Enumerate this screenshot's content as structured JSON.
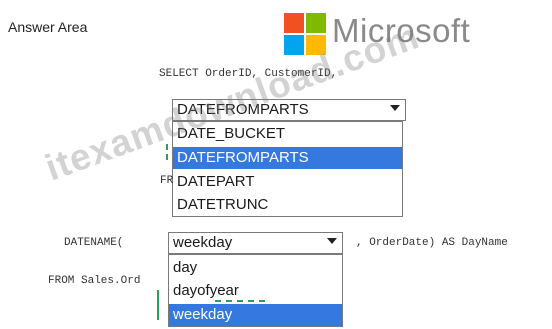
{
  "header": {
    "answer_area": "Answer Area",
    "brand": "Microsoft"
  },
  "code": {
    "line1": "SELECT OrderID, CustomerID,",
    "line_from_prefix": "FR",
    "datename_prefix": "DATENAME(",
    "datename_suffix": ", OrderDate) AS DayName",
    "from_line": "FROM Sales.Ord"
  },
  "dropdown1": {
    "selected": "DATEFROMPARTS",
    "options": [
      "DATE_BUCKET",
      "DATEFROMPARTS",
      "DATEPART",
      "DATETRUNC"
    ],
    "highlighted_index": 1
  },
  "dropdown2": {
    "selected": "weekday",
    "options": [
      "day",
      "dayofyear",
      "weekday"
    ],
    "highlighted_index": 2
  },
  "watermark": "itexamdownload.com",
  "colors": {
    "highlight": "#3478e0",
    "ms_red": "#f25022",
    "ms_green": "#7fba00",
    "ms_blue": "#00a4ef",
    "ms_yellow": "#ffb900"
  }
}
